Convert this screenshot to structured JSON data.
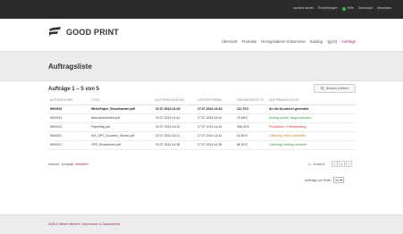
{
  "topnav": {
    "username": "caroline.winter",
    "settings": "Einstellungen",
    "help": "Hilfe",
    "download": "Download",
    "logout": "Abmelden"
  },
  "brand": {
    "name": "GOOD PRINT"
  },
  "mainnav": {
    "overview": "Übersicht",
    "products": "Produkte",
    "uploaded_docs": "Hochgeladene Dokumente",
    "catalog": "Katalog",
    "cart_count": "(0)",
    "orders": "Aufträge"
  },
  "page": {
    "title": "Auftragsliste"
  },
  "orders": {
    "count_title": "Aufträge 1 – 5 von 5",
    "search_button": "Suchen & filtern",
    "columns": [
      "AUFTRAGSNR.",
      "TITEL",
      "AUFTRAGSDATUM",
      "LIEFERTERMIN",
      "GESAMTBRUTTO",
      "AUFTRAGSSTATUS"
    ],
    "rows": [
      [
        "W00005",
        "WhitePaper_Einzelhandel.pdf",
        "22.07.2016 14:45",
        "27.07.2016 14:45",
        "111,75 €",
        "An die Druckerei gesendet"
      ],
      [
        "W00004",
        "Abschlussbericht.pdf",
        "22.07.2016 14:44",
        "27.07.2016 14:44",
        "79,68 €",
        "Auftrag prüfen: Abgeschlossen"
      ],
      [
        "W00003",
        "Paperflag.pdf",
        "22.07.2016 14:43",
        "27.07.2016 14:43",
        "336,40 €",
        "Produktion: In Bearbeitung"
      ],
      [
        "W00002",
        "KM_OPS_Success_Stories.pdf",
        "22.07.2016 14:41",
        "27.07.2016 14:41",
        "63,65 €",
        "Lieferung: Wird vorbereitet"
      ],
      [
        "W00001",
        "OPS_Broschuere.pdf",
        "22.07.2016 14:38",
        "27.07.2016 14:38",
        "86,90 €",
        "Lieferung: Auftrag versandt"
      ]
    ]
  },
  "view": {
    "label": "Ansicht:",
    "compact": "kompakt",
    "detailed": "detailliert"
  },
  "pagination": {
    "info": "1 – 5 von 5",
    "prev": "‹",
    "current": "1",
    "next": "›"
  },
  "per_page": {
    "label": "Aufträge pro Seite:",
    "value": "10"
  },
  "footer": {
    "link1": "AGB & Widerrufsrecht",
    "separator": "|",
    "link2": "Impressum & Datenschutz"
  },
  "colors": {
    "accent": "#9b2c6f",
    "topbar": "#2b2b2b",
    "status_red": "#d0362b",
    "status_green": "#3a9a3a",
    "status_orange": "#e07b1a"
  }
}
